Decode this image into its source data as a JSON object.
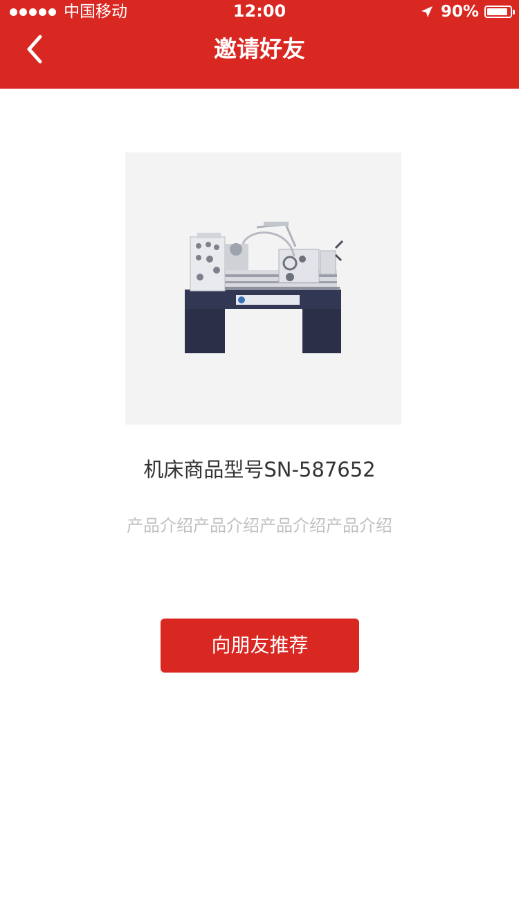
{
  "status_bar": {
    "carrier": "中国移动",
    "time": "12:00",
    "battery_percent": "90%",
    "battery_level": 0.9,
    "signal_bars": 5
  },
  "nav": {
    "back_icon": "chevron-left-icon",
    "title": "邀请好友"
  },
  "product": {
    "image_subject": "lathe machine",
    "name": "机床商品型号SN-587652",
    "intro": "产品介绍产品介绍产品介绍产品介绍"
  },
  "actions": {
    "recommend_label": "向朋友推荐"
  },
  "colors": {
    "brand_red": "#d92721",
    "image_background": "#f3f3f3",
    "title_text": "#333333",
    "muted_text": "#c0c0c0"
  }
}
